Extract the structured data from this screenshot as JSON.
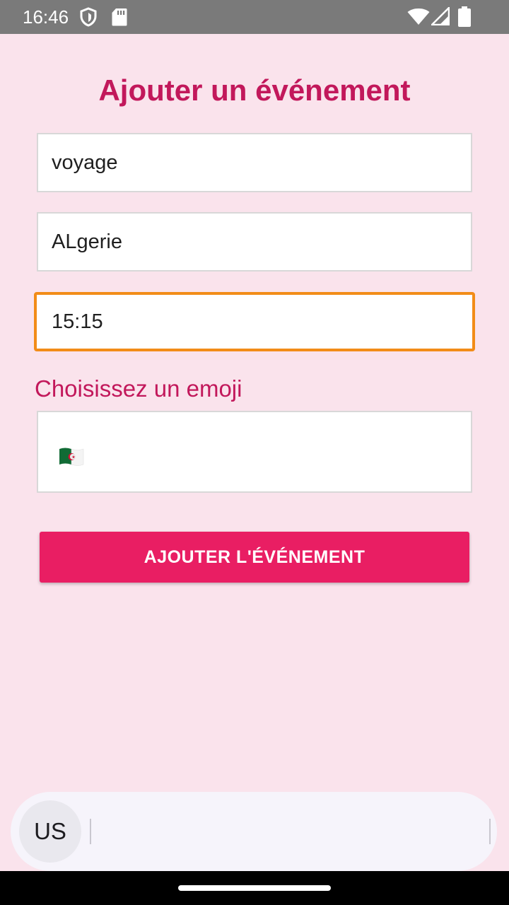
{
  "status_bar": {
    "time": "16:46",
    "icons": [
      "shield-icon",
      "sd-card-icon",
      "wifi-icon",
      "signal-icon",
      "battery-icon"
    ]
  },
  "form": {
    "title": "Ajouter un événement",
    "fields": [
      {
        "name": "title",
        "value": "voyage"
      },
      {
        "name": "location",
        "value": "ALgerie"
      },
      {
        "name": "time",
        "value": "15:15",
        "focused": true
      }
    ],
    "emoji_label": "Choisissez un emoji",
    "selected_emoji": "algeria-flag",
    "submit_label": "AJOUTER L'ÉVÉNEMENT"
  },
  "keyboard": {
    "language": "US"
  },
  "colors": {
    "background": "#fae3ec",
    "accent": "#c2185b",
    "button": "#e91e63",
    "focus_border": "#f28c18"
  }
}
